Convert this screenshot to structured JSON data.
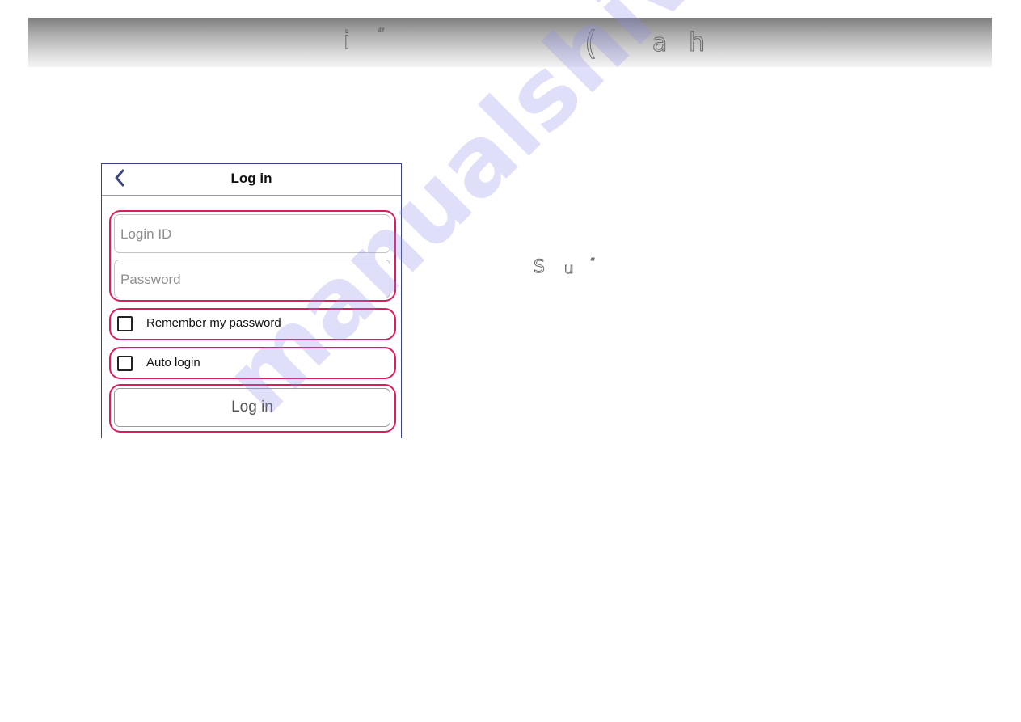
{
  "header": {
    "stray_glyphs_left": [
      "i",
      "“"
    ],
    "stray_glyphs_right": [
      "(",
      "a",
      "h"
    ]
  },
  "body_glyphs": [
    "S",
    "u",
    "“"
  ],
  "watermark": "manualshive.com",
  "screen": {
    "nav": {
      "back_icon": "chevron-left-icon",
      "title": "Log in"
    },
    "form": {
      "login_id": {
        "value": "",
        "placeholder": "Login ID"
      },
      "password": {
        "value": "",
        "placeholder": "Password"
      },
      "remember_password": {
        "label": "Remember my password",
        "checked": false
      },
      "auto_login": {
        "label": "Auto login",
        "checked": false
      },
      "submit_label": "Log in"
    },
    "highlight_color": "#e01a5f",
    "accent_color": "#3a4680"
  }
}
